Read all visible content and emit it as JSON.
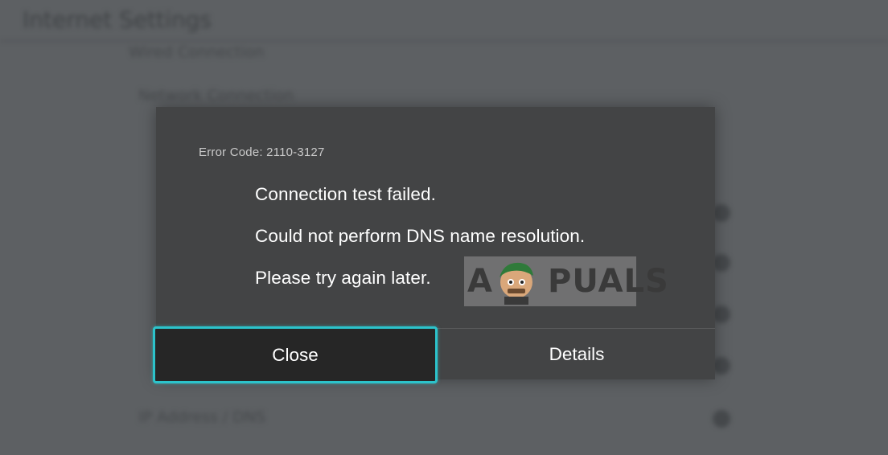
{
  "background": {
    "title": "Internet Settings",
    "rows": [
      "Wired Connection",
      "Network Connection"
    ],
    "footer_row": "IP Address / DNS"
  },
  "dialog": {
    "error_code": "Error Code: 2110-3127",
    "messages": [
      "Connection test failed.",
      "Could not perform DNS name resolution.",
      "Please try again later."
    ],
    "buttons": {
      "close": "Close",
      "details": "Details"
    }
  },
  "watermark": {
    "brand_first": "A",
    "brand_rest": "PUALS"
  },
  "colors": {
    "focus_outline": "#2cc3cb",
    "dialog_bg": "#434445",
    "screen_bg": "#5d6063"
  }
}
